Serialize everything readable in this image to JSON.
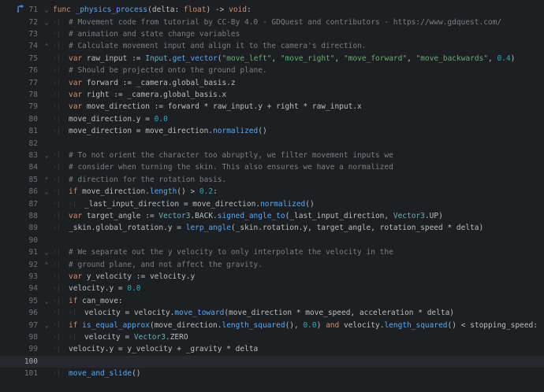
{
  "editor": {
    "lines": [
      {
        "num": "71",
        "fold": "⌄",
        "tabs": 0,
        "tokens": [
          {
            "t": "func ",
            "c": "k"
          },
          {
            "t": "_physics_process",
            "c": "f"
          },
          {
            "t": "(delta: ",
            "c": "p"
          },
          {
            "t": "float",
            "c": "k"
          },
          {
            "t": ") -> ",
            "c": "p"
          },
          {
            "t": "void",
            "c": "k"
          },
          {
            "t": ":",
            "c": "p"
          }
        ]
      },
      {
        "num": "72",
        "fold": "⌄",
        "tabs": 1,
        "tokens": [
          {
            "t": "# Movement code from tutorial by CC-By 4.0 - GDQuest and contributors - https://www.gdquest.com/",
            "c": "c"
          }
        ]
      },
      {
        "num": "73",
        "fold": "",
        "tabs": 1,
        "tokens": [
          {
            "t": "# animation and state change variables",
            "c": "c"
          }
        ]
      },
      {
        "num": "74",
        "fold": "⌃",
        "tabs": 1,
        "tokens": [
          {
            "t": "# Calculate movement input and align it to the camera's direction.",
            "c": "c"
          }
        ]
      },
      {
        "num": "75",
        "fold": "",
        "tabs": 1,
        "tokens": [
          {
            "t": "var ",
            "c": "k"
          },
          {
            "t": "raw_input := ",
            "c": "p"
          },
          {
            "t": "Input",
            "c": "t"
          },
          {
            "t": ".",
            "c": "p"
          },
          {
            "t": "get_vector",
            "c": "f"
          },
          {
            "t": "(",
            "c": "p"
          },
          {
            "t": "\"move_left\"",
            "c": "s"
          },
          {
            "t": ", ",
            "c": "p"
          },
          {
            "t": "\"move_right\"",
            "c": "s"
          },
          {
            "t": ", ",
            "c": "p"
          },
          {
            "t": "\"move_forward\"",
            "c": "s"
          },
          {
            "t": ", ",
            "c": "p"
          },
          {
            "t": "\"move_backwards\"",
            "c": "s"
          },
          {
            "t": ", ",
            "c": "p"
          },
          {
            "t": "0.4",
            "c": "n"
          },
          {
            "t": ")",
            "c": "p"
          }
        ]
      },
      {
        "num": "76",
        "fold": "",
        "tabs": 1,
        "tokens": [
          {
            "t": "# Should be projected onto the ground plane.",
            "c": "c"
          }
        ]
      },
      {
        "num": "77",
        "fold": "",
        "tabs": 1,
        "tokens": [
          {
            "t": "var ",
            "c": "k"
          },
          {
            "t": "forward := _camera.global_basis.z",
            "c": "p"
          }
        ]
      },
      {
        "num": "78",
        "fold": "",
        "tabs": 1,
        "tokens": [
          {
            "t": "var ",
            "c": "k"
          },
          {
            "t": "right := _camera.global_basis.x",
            "c": "p"
          }
        ]
      },
      {
        "num": "79",
        "fold": "",
        "tabs": 1,
        "tokens": [
          {
            "t": "var ",
            "c": "k"
          },
          {
            "t": "move_direction := forward * raw_input.y + right * raw_input.x",
            "c": "p"
          }
        ]
      },
      {
        "num": "80",
        "fold": "",
        "tabs": 1,
        "tokens": [
          {
            "t": "move_direction.y = ",
            "c": "p"
          },
          {
            "t": "0.0",
            "c": "n"
          }
        ]
      },
      {
        "num": "81",
        "fold": "",
        "tabs": 1,
        "tokens": [
          {
            "t": "move_direction = move_direction.",
            "c": "p"
          },
          {
            "t": "normalized",
            "c": "f"
          },
          {
            "t": "()",
            "c": "p"
          }
        ]
      },
      {
        "num": "82",
        "fold": "",
        "tabs": 0,
        "tokens": []
      },
      {
        "num": "83",
        "fold": "⌄",
        "tabs": 1,
        "tokens": [
          {
            "t": "# To not orient the character too abruptly, we filter movement inputs we",
            "c": "c"
          }
        ]
      },
      {
        "num": "84",
        "fold": "",
        "tabs": 1,
        "tokens": [
          {
            "t": "# consider when turning the skin. This also ensures we have a normalized",
            "c": "c"
          }
        ]
      },
      {
        "num": "85",
        "fold": "⌃",
        "tabs": 1,
        "tokens": [
          {
            "t": "# direction for the rotation basis.",
            "c": "c"
          }
        ]
      },
      {
        "num": "86",
        "fold": "⌄",
        "tabs": 1,
        "tokens": [
          {
            "t": "if ",
            "c": "k"
          },
          {
            "t": "move_direction.",
            "c": "p"
          },
          {
            "t": "length",
            "c": "f"
          },
          {
            "t": "() > ",
            "c": "p"
          },
          {
            "t": "0.2",
            "c": "n"
          },
          {
            "t": ":",
            "c": "p"
          }
        ]
      },
      {
        "num": "87",
        "fold": "",
        "tabs": 2,
        "tokens": [
          {
            "t": "_last_input_direction = move_direction.",
            "c": "p"
          },
          {
            "t": "normalized",
            "c": "f"
          },
          {
            "t": "()",
            "c": "p"
          }
        ]
      },
      {
        "num": "88",
        "fold": "",
        "tabs": 1,
        "tokens": [
          {
            "t": "var ",
            "c": "k"
          },
          {
            "t": "target_angle := ",
            "c": "p"
          },
          {
            "t": "Vector3",
            "c": "t"
          },
          {
            "t": ".BACK.",
            "c": "p"
          },
          {
            "t": "signed_angle_to",
            "c": "f"
          },
          {
            "t": "(_last_input_direction, ",
            "c": "p"
          },
          {
            "t": "Vector3",
            "c": "t"
          },
          {
            "t": ".UP)",
            "c": "p"
          }
        ]
      },
      {
        "num": "89",
        "fold": "",
        "tabs": 1,
        "tokens": [
          {
            "t": "_skin.global_rotation.y = ",
            "c": "p"
          },
          {
            "t": "lerp_angle",
            "c": "f"
          },
          {
            "t": "(_skin.rotation.y, target_angle, rotation_speed * delta)",
            "c": "p"
          }
        ]
      },
      {
        "num": "90",
        "fold": "",
        "tabs": 0,
        "tokens": []
      },
      {
        "num": "91",
        "fold": "⌄",
        "tabs": 1,
        "tokens": [
          {
            "t": "# We separate out the y velocity to only interpolate the velocity in the",
            "c": "c"
          }
        ]
      },
      {
        "num": "92",
        "fold": "⌃",
        "tabs": 1,
        "tokens": [
          {
            "t": "# ground plane, and not affect the gravity.",
            "c": "c"
          }
        ]
      },
      {
        "num": "93",
        "fold": "",
        "tabs": 1,
        "tokens": [
          {
            "t": "var ",
            "c": "k"
          },
          {
            "t": "y_velocity := velocity.y",
            "c": "p"
          }
        ]
      },
      {
        "num": "94",
        "fold": "",
        "tabs": 1,
        "tokens": [
          {
            "t": "velocity.y = ",
            "c": "p"
          },
          {
            "t": "0.0",
            "c": "n"
          }
        ]
      },
      {
        "num": "95",
        "fold": "⌄",
        "tabs": 1,
        "tokens": [
          {
            "t": "if ",
            "c": "k"
          },
          {
            "t": "can_move:",
            "c": "p"
          }
        ]
      },
      {
        "num": "96",
        "fold": "",
        "tabs": 2,
        "tokens": [
          {
            "t": "velocity = velocity.",
            "c": "p"
          },
          {
            "t": "move_toward",
            "c": "f"
          },
          {
            "t": "(move_direction * move_speed, acceleration * delta)",
            "c": "p"
          }
        ]
      },
      {
        "num": "97",
        "fold": "⌄",
        "tabs": 1,
        "tokens": [
          {
            "t": "if ",
            "c": "k"
          },
          {
            "t": "is_equal_approx",
            "c": "f"
          },
          {
            "t": "(move_direction.",
            "c": "p"
          },
          {
            "t": "length_squared",
            "c": "f"
          },
          {
            "t": "(), ",
            "c": "p"
          },
          {
            "t": "0.0",
            "c": "n"
          },
          {
            "t": ") ",
            "c": "p"
          },
          {
            "t": "and ",
            "c": "k"
          },
          {
            "t": "velocity.",
            "c": "p"
          },
          {
            "t": "length_squared",
            "c": "f"
          },
          {
            "t": "() < stopping_speed:",
            "c": "p"
          }
        ]
      },
      {
        "num": "98",
        "fold": "",
        "tabs": 2,
        "tokens": [
          {
            "t": "velocity = ",
            "c": "p"
          },
          {
            "t": "Vector3",
            "c": "t"
          },
          {
            "t": ".ZERO",
            "c": "p"
          }
        ]
      },
      {
        "num": "99",
        "fold": "",
        "tabs": 1,
        "tokens": [
          {
            "t": "velocity.y = y_velocity + _gravity * delta",
            "c": "p"
          }
        ]
      },
      {
        "num": "100",
        "fold": "",
        "tabs": 0,
        "current": true,
        "tokens": []
      },
      {
        "num": "101",
        "fold": "",
        "tabs": 1,
        "tokens": [
          {
            "t": "move_and_slide",
            "c": "f"
          },
          {
            "t": "()",
            "c": "p"
          }
        ]
      },
      {
        "num": "",
        "fold": "",
        "tabs": 0,
        "tokens": []
      }
    ],
    "gutter_icon_line": "71",
    "gutter_icon": "override-arrow-icon",
    "tab_glyph": "›|",
    "colors": {
      "background": "#1e1f22",
      "keyword": "#cf8e6d",
      "function": "#56a8f5",
      "string": "#6aab73",
      "number": "#2aacb8",
      "comment": "#7a7e85",
      "type": "#6ab0b8",
      "plain": "#bcbec4"
    }
  }
}
